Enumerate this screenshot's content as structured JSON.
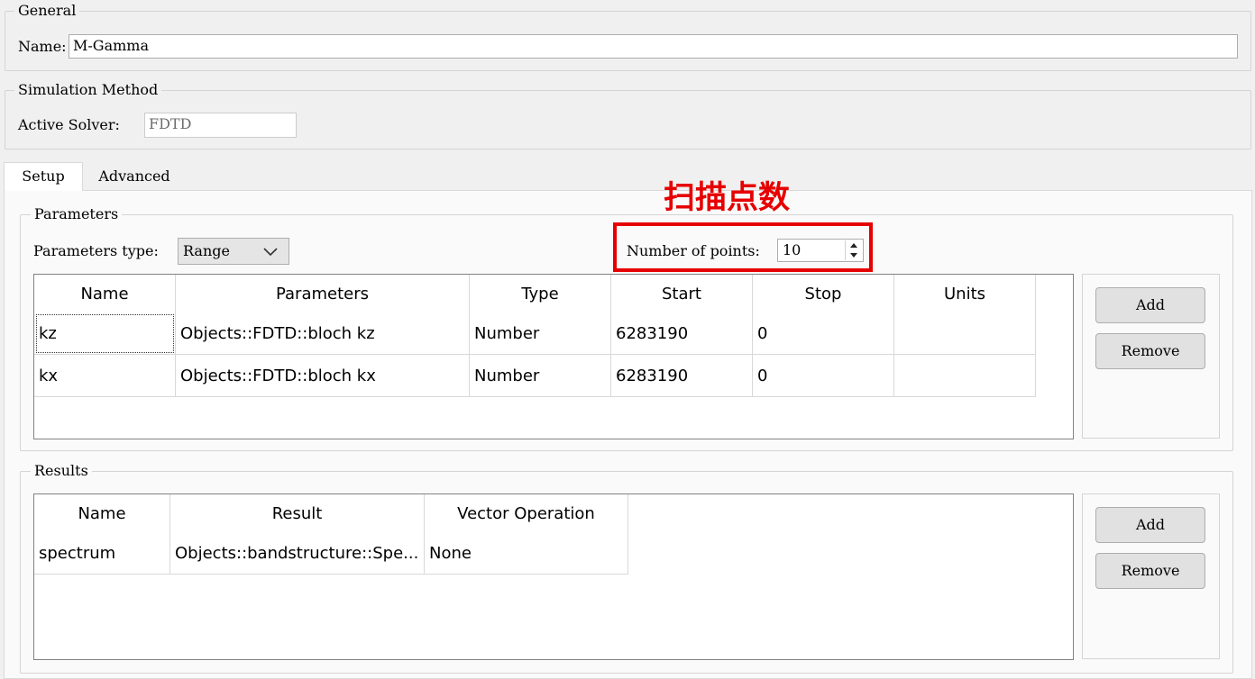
{
  "general": {
    "title": "General",
    "name_label": "Name:",
    "name_value": "M-Gamma"
  },
  "simulation": {
    "title": "Simulation Method",
    "solver_label": "Active Solver:",
    "solver_value": "FDTD"
  },
  "tabs": [
    {
      "label": "Setup",
      "active": true
    },
    {
      "label": "Advanced",
      "active": false
    }
  ],
  "annotation": {
    "text": "扫描点数",
    "color": "#e60000"
  },
  "parameters": {
    "title": "Parameters",
    "type_label": "Parameters type:",
    "type_value": "Range",
    "points_label": "Number of points:",
    "points_value": "10",
    "columns": [
      "Name",
      "Parameters",
      "Type",
      "Start",
      "Stop",
      "Units"
    ],
    "rows": [
      [
        "kz",
        "Objects::FDTD::bloch kz",
        "Number",
        "6283190",
        "0",
        ""
      ],
      [
        "kx",
        "Objects::FDTD::bloch kx",
        "Number",
        "6283190",
        "0",
        ""
      ]
    ],
    "add_label": "Add",
    "remove_label": "Remove"
  },
  "results": {
    "title": "Results",
    "columns": [
      "Name",
      "Result",
      "Vector Operation"
    ],
    "rows": [
      [
        "spectrum",
        "Objects::bandstructure::Spe...",
        "None"
      ]
    ],
    "add_label": "Add",
    "remove_label": "Remove"
  }
}
